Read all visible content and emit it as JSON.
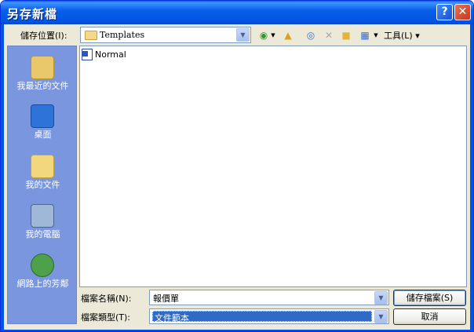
{
  "window": {
    "title": "另存新檔"
  },
  "toolbar": {
    "save_in_label": "儲存位置(I):",
    "location": "Templates",
    "tools_label": "工具(L)"
  },
  "places": [
    {
      "label": "我最近的文件",
      "icon": "recent-documents-icon"
    },
    {
      "label": "桌面",
      "icon": "desktop-icon"
    },
    {
      "label": "我的文件",
      "icon": "my-documents-icon"
    },
    {
      "label": "我的電腦",
      "icon": "my-computer-icon"
    },
    {
      "label": "網路上的芳鄰",
      "icon": "network-places-icon"
    }
  ],
  "files": [
    {
      "name": "Normal",
      "icon": "word-document-icon"
    }
  ],
  "form": {
    "filename_label": "檔案名稱(N):",
    "filename_value": "報價單",
    "filetype_label": "檔案類型(T):",
    "filetype_value": "文件範本",
    "save_button": "儲存檔案(S)",
    "cancel_button": "取消"
  },
  "colors": {
    "titlebar": "#0054E3",
    "places_bar": "#7A96DF",
    "selection": "#316AC5"
  }
}
